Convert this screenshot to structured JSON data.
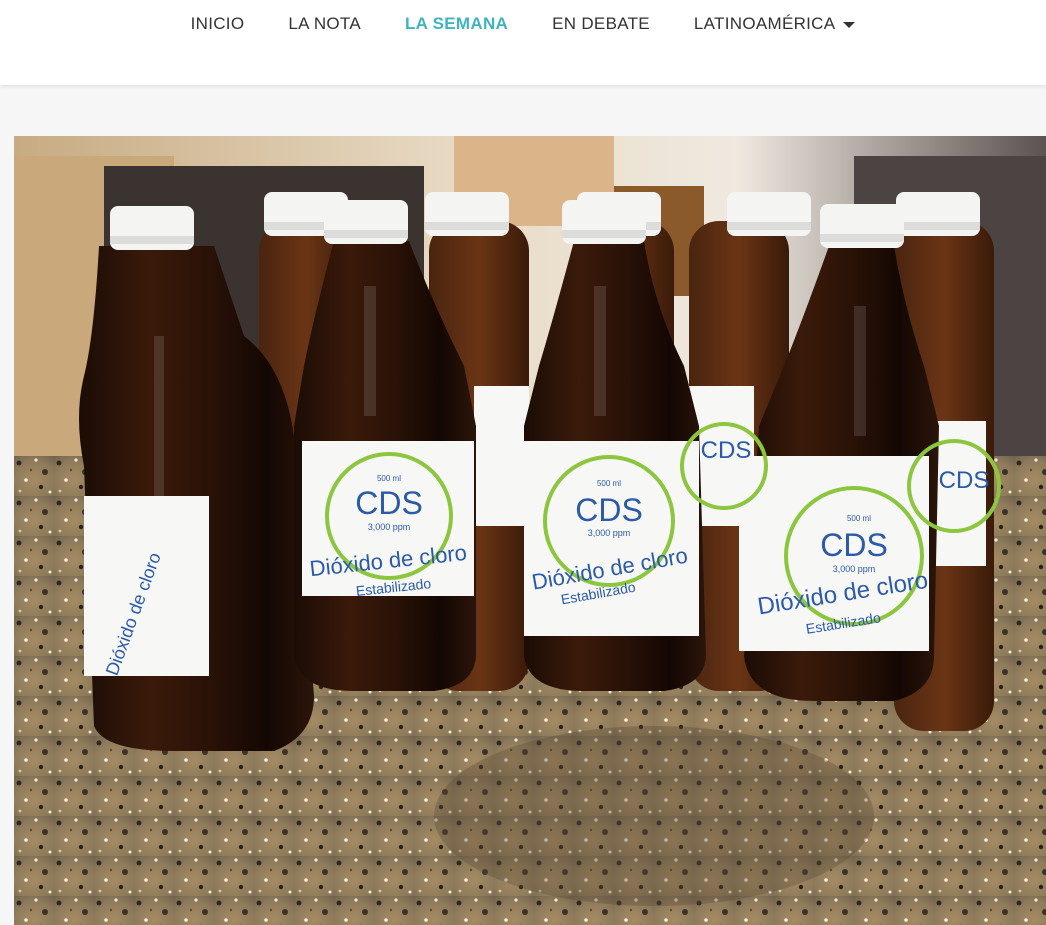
{
  "nav": {
    "items": [
      {
        "label": "INICIO",
        "active": false
      },
      {
        "label": "LA NOTA",
        "active": false
      },
      {
        "label": "LA SEMANA",
        "active": true
      },
      {
        "label": "EN DEBATE",
        "active": false
      },
      {
        "label": "LATINOAMÉRICA",
        "active": false,
        "dropdown": true
      }
    ],
    "active_color": "#3fb3c4",
    "text_color": "#333333",
    "dropdown_icon": "caret-down-icon"
  },
  "photo": {
    "label": {
      "volume": "500 ml",
      "brand": "CDS",
      "concentration": "3,000 ppm",
      "product": "Dióxido de cloro",
      "subtitle": "Estabilizado",
      "accent_color": "#8cc63f",
      "text_color": "#2b5aa8"
    }
  }
}
